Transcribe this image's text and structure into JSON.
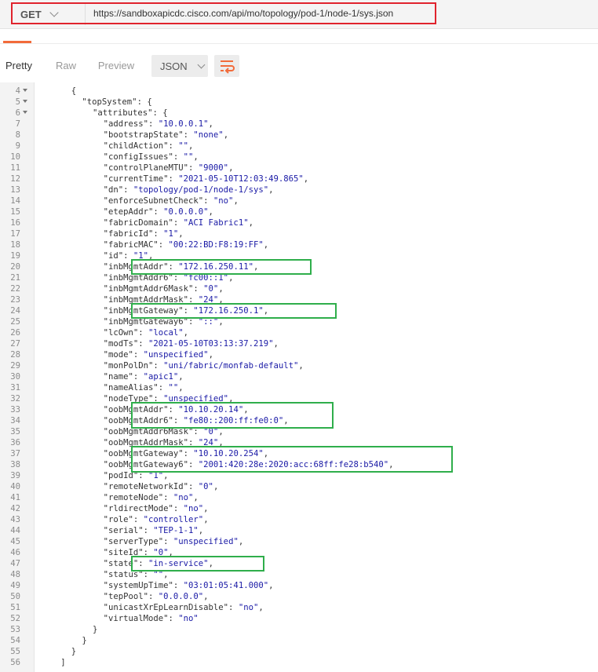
{
  "request": {
    "method": "GET",
    "url": "https://sandboxapicdc.cisco.com/api/mo/topology/pod-1/node-1/sys.json"
  },
  "toolbar": {
    "pretty": "Pretty",
    "raw": "Raw",
    "preview": "Preview",
    "format": "JSON"
  },
  "colors": {
    "accent": "#f26b3a",
    "red_highlight": "#e0232d",
    "green_highlight": "#2fae4b",
    "string_color": "#1a1aa6"
  },
  "code_lines": [
    {
      "n": "4",
      "fold": true,
      "indent": 12,
      "key": "",
      "val": "",
      "raw": "{"
    },
    {
      "n": "5",
      "fold": true,
      "indent": 16,
      "key": "topSystem",
      "val": "",
      "raw": ": {"
    },
    {
      "n": "6",
      "fold": true,
      "indent": 20,
      "key": "attributes",
      "val": "",
      "raw": ": {"
    },
    {
      "n": "7",
      "indent": 24,
      "key": "address",
      "val": "10.0.0.1",
      "raw": ","
    },
    {
      "n": "8",
      "indent": 24,
      "key": "bootstrapState",
      "val": "none",
      "raw": ","
    },
    {
      "n": "9",
      "indent": 24,
      "key": "childAction",
      "val": "",
      "raw": ","
    },
    {
      "n": "10",
      "indent": 24,
      "key": "configIssues",
      "val": "",
      "raw": ","
    },
    {
      "n": "11",
      "indent": 24,
      "key": "controlPlaneMTU",
      "val": "9000",
      "raw": ","
    },
    {
      "n": "12",
      "indent": 24,
      "key": "currentTime",
      "val": "2021-05-10T12:03:49.865",
      "raw": ","
    },
    {
      "n": "13",
      "indent": 24,
      "key": "dn",
      "val": "topology/pod-1/node-1/sys",
      "raw": ","
    },
    {
      "n": "14",
      "indent": 24,
      "key": "enforceSubnetCheck",
      "val": "no",
      "raw": ","
    },
    {
      "n": "15",
      "indent": 24,
      "key": "etepAddr",
      "val": "0.0.0.0",
      "raw": ","
    },
    {
      "n": "16",
      "indent": 24,
      "key": "fabricDomain",
      "val": "ACI Fabric1",
      "raw": ","
    },
    {
      "n": "17",
      "indent": 24,
      "key": "fabricId",
      "val": "1",
      "raw": ","
    },
    {
      "n": "18",
      "indent": 24,
      "key": "fabricMAC",
      "val": "00:22:BD:F8:19:FF",
      "raw": ","
    },
    {
      "n": "19",
      "indent": 24,
      "key": "id",
      "val": "1",
      "raw": ","
    },
    {
      "n": "20",
      "indent": 24,
      "key": "inbMgmtAddr",
      "val": "172.16.250.11",
      "raw": ","
    },
    {
      "n": "21",
      "indent": 24,
      "key": "inbMgmtAddr6",
      "val": "fc00::1",
      "raw": ","
    },
    {
      "n": "22",
      "indent": 24,
      "key": "inbMgmtAddr6Mask",
      "val": "0",
      "raw": ","
    },
    {
      "n": "23",
      "indent": 24,
      "key": "inbMgmtAddrMask",
      "val": "24",
      "raw": ","
    },
    {
      "n": "24",
      "indent": 24,
      "key": "inbMgmtGateway",
      "val": "172.16.250.1",
      "raw": ","
    },
    {
      "n": "25",
      "indent": 24,
      "key": "inbMgmtGateway6",
      "val": "::",
      "raw": ","
    },
    {
      "n": "26",
      "indent": 24,
      "key": "lcOwn",
      "val": "local",
      "raw": ","
    },
    {
      "n": "27",
      "indent": 24,
      "key": "modTs",
      "val": "2021-05-10T03:13:37.219",
      "raw": ","
    },
    {
      "n": "28",
      "indent": 24,
      "key": "mode",
      "val": "unspecified",
      "raw": ","
    },
    {
      "n": "29",
      "indent": 24,
      "key": "monPolDn",
      "val": "uni/fabric/monfab-default",
      "raw": ","
    },
    {
      "n": "30",
      "indent": 24,
      "key": "name",
      "val": "apic1",
      "raw": ","
    },
    {
      "n": "31",
      "indent": 24,
      "key": "nameAlias",
      "val": "",
      "raw": ","
    },
    {
      "n": "32",
      "indent": 24,
      "key": "nodeType",
      "val": "unspecified",
      "raw": ","
    },
    {
      "n": "33",
      "indent": 24,
      "key": "oobMgmtAddr",
      "val": "10.10.20.14",
      "raw": ","
    },
    {
      "n": "34",
      "indent": 24,
      "key": "oobMgmtAddr6",
      "val": "fe80::200:ff:fe0:0",
      "raw": ","
    },
    {
      "n": "35",
      "indent": 24,
      "key": "oobMgmtAddr6Mask",
      "val": "0",
      "raw": ","
    },
    {
      "n": "36",
      "indent": 24,
      "key": "oobMgmtAddrMask",
      "val": "24",
      "raw": ","
    },
    {
      "n": "37",
      "indent": 24,
      "key": "oobMgmtGateway",
      "val": "10.10.20.254",
      "raw": ","
    },
    {
      "n": "38",
      "indent": 24,
      "key": "oobMgmtGateway6",
      "val": "2001:420:28e:2020:acc:68ff:fe28:b540",
      "raw": ","
    },
    {
      "n": "39",
      "indent": 24,
      "key": "podId",
      "val": "1",
      "raw": ","
    },
    {
      "n": "40",
      "indent": 24,
      "key": "remoteNetworkId",
      "val": "0",
      "raw": ","
    },
    {
      "n": "41",
      "indent": 24,
      "key": "remoteNode",
      "val": "no",
      "raw": ","
    },
    {
      "n": "42",
      "indent": 24,
      "key": "rldirectMode",
      "val": "no",
      "raw": ","
    },
    {
      "n": "43",
      "indent": 24,
      "key": "role",
      "val": "controller",
      "raw": ","
    },
    {
      "n": "44",
      "indent": 24,
      "key": "serial",
      "val": "TEP-1-1",
      "raw": ","
    },
    {
      "n": "45",
      "indent": 24,
      "key": "serverType",
      "val": "unspecified",
      "raw": ","
    },
    {
      "n": "46",
      "indent": 24,
      "key": "siteId",
      "val": "0",
      "raw": ","
    },
    {
      "n": "47",
      "indent": 24,
      "key": "state",
      "val": "in-service",
      "raw": ","
    },
    {
      "n": "48",
      "indent": 24,
      "key": "status",
      "val": "",
      "raw": ","
    },
    {
      "n": "49",
      "indent": 24,
      "key": "systemUpTime",
      "val": "03:01:05:41.000",
      "raw": ","
    },
    {
      "n": "50",
      "indent": 24,
      "key": "tepPool",
      "val": "0.0.0.0",
      "raw": ","
    },
    {
      "n": "51",
      "indent": 24,
      "key": "unicastXrEpLearnDisable",
      "val": "no",
      "raw": ","
    },
    {
      "n": "52",
      "indent": 24,
      "key": "virtualMode",
      "val": "no",
      "raw": ""
    },
    {
      "n": "53",
      "indent": 20,
      "key": "",
      "val": "",
      "raw": "}"
    },
    {
      "n": "54",
      "indent": 16,
      "key": "",
      "val": "",
      "raw": "}"
    },
    {
      "n": "55",
      "indent": 12,
      "key": "",
      "val": "",
      "raw": "}"
    },
    {
      "n": "56",
      "indent": 8,
      "key": "",
      "val": "",
      "raw": "]"
    }
  ],
  "highlighted_lines": [
    [
      "20"
    ],
    [
      "24"
    ],
    [
      "33",
      "34"
    ],
    [
      "37",
      "38"
    ],
    [
      "47"
    ]
  ]
}
